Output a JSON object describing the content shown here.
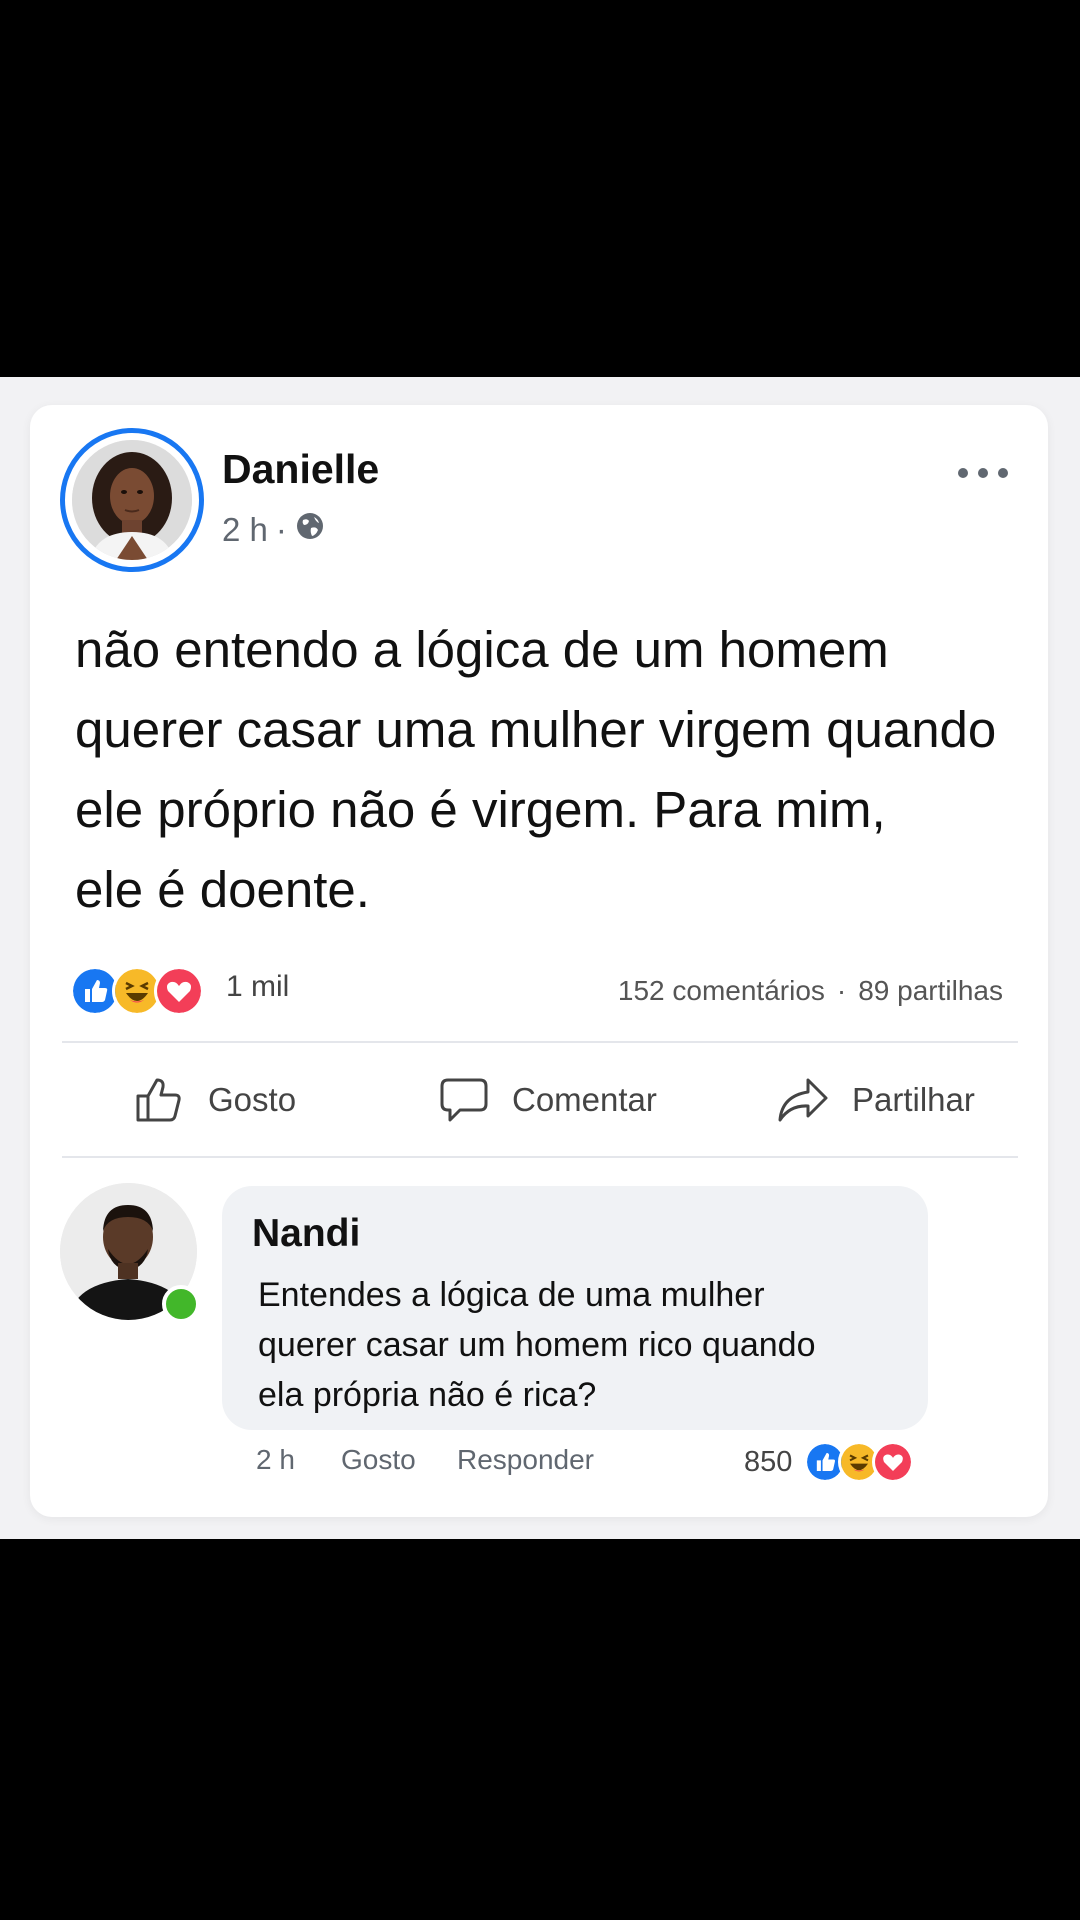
{
  "post": {
    "author": "Danielle",
    "time": "2 h",
    "separator": "·",
    "audience_icon": "globe-icon",
    "text_lines": [
      "não entendo a lógica de um homem",
      "querer casar uma mulher virgem quando",
      "ele próprio não é virgem. Para mim,",
      "ele é doente."
    ],
    "reactions_count": "1 mil",
    "comments": "152 comentários",
    "dot": "·",
    "shares": "89 partilhas"
  },
  "actions": {
    "like": "Gosto",
    "comment": "Comentar",
    "share": "Partilhar"
  },
  "comment": {
    "author": "Nandi",
    "text_lines": [
      "Entendes a lógica de uma mulher",
      "querer casar um homem rico quando",
      "ela própria não é rica?"
    ],
    "time": "2 h",
    "like": "Gosto",
    "reply": "Responder",
    "reactions_count": "850",
    "online": true
  },
  "colors": {
    "accent": "#1877f2",
    "like_reaction": "#1877f2",
    "haha_reaction": "#f7b928",
    "love_reaction": "#f33e58",
    "online": "#42b72a"
  }
}
